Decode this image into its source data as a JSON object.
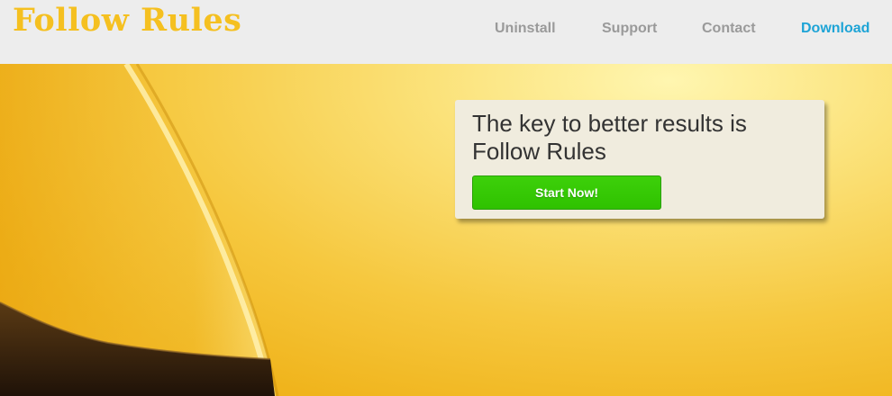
{
  "header": {
    "logo_text": "Follow Rules",
    "nav": [
      {
        "label": "Uninstall"
      },
      {
        "label": "Support"
      },
      {
        "label": "Contact"
      },
      {
        "label": "Download"
      }
    ]
  },
  "hero": {
    "headline": "The key to better results is Follow Rules",
    "cta_label": "Start Now!"
  },
  "colors": {
    "logo": "#f5c020",
    "nav_text": "#9a9a9a",
    "nav_active": "#1ea4d6",
    "cta_green": "#33c500",
    "card_bg": "#f0ecde"
  }
}
